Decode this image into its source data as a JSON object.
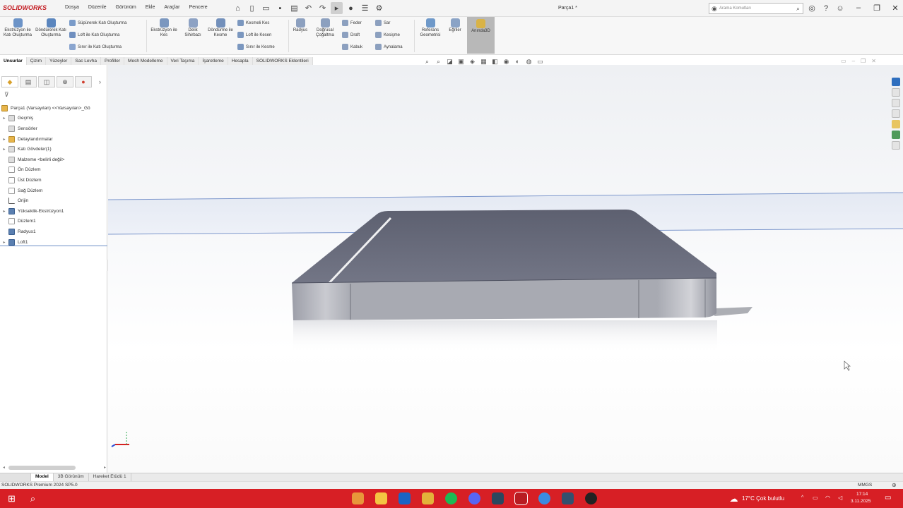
{
  "app": {
    "logo": "SOLIDWORKS",
    "document_title": "Parça1 *"
  },
  "menu": [
    "Dosya",
    "Düzenle",
    "Görünüm",
    "Ekle",
    "Araçlar",
    "Pencere"
  ],
  "search": {
    "placeholder": "Arama Komutları"
  },
  "ribbon": {
    "extrude_boss": "Ekstrüzyon ile Katı Oluşturma",
    "revolve_boss": "Döndürerek Katı Oluşturma",
    "sweep_boss": "Süpürerek Katı Oluşturma",
    "loft_boss": "Loft ile Katı Oluşturma",
    "boundary_boss": "Sınır ile Katı Oluşturma",
    "extruded_cut": "Ekstrüzyon ile Kes",
    "hole_wizard": "Delik Sihirbazı",
    "revolved_cut": "Döndürme ile Kesme",
    "swept_cut": "Kesmeli Kes",
    "lofted_cut": "Loft ile Kesen",
    "boundary_cut": "Sınır ile Kesme",
    "fillet": "Radyus",
    "linear_pattern": "Doğrusal Çoğaltma",
    "rib": "Feder",
    "draft": "Draft",
    "shell": "Kabuk",
    "wrap": "Sar",
    "intersect": "Kesişme",
    "mirror": "Aynalama",
    "reference_geometry": "Referans Geometrisi",
    "curves": "Eğriler",
    "instant3d": "Anında3D"
  },
  "tabs": [
    "Unsurlar",
    "Çizim",
    "Yüzeyler",
    "Sac Levha",
    "Profiller",
    "Mesh Modelleme",
    "Veri Taşıma",
    "İşaretleme",
    "Hesapla",
    "SOLIDWORKS Eklentileri"
  ],
  "tree": {
    "root": "Parça1 (Varsayılan) <<Varsayılan>_Gö",
    "items": [
      "Geçmiş",
      "Sensörler",
      "Detaylandırmalar",
      "Katı Gövdeler(1)",
      "Malzeme <belirli değil>",
      "Ön Düzlem",
      "Üst Düzlem",
      "Sağ Düzlem",
      "Orijin",
      "Yükseklik-Ekstrüzyon1",
      "Düzlem1",
      "Radyus1",
      "Loft1"
    ]
  },
  "bottom_tabs": [
    "",
    "Model",
    "3B Görünüm",
    "Hareket Etüdü 1"
  ],
  "status": {
    "text": "SOLIDWORKS Premium 2024 SP5.0",
    "units": "MMGS"
  },
  "taskbar": {
    "weather": "17°C  Çok bulutlu",
    "time": "17:14",
    "date": "3.11.2025"
  },
  "colors": {
    "taskbar": "#d71f25",
    "model_top": "#6b6e7c",
    "model_side": "#a9abb4",
    "plane_edge": "#6c8fc6"
  }
}
